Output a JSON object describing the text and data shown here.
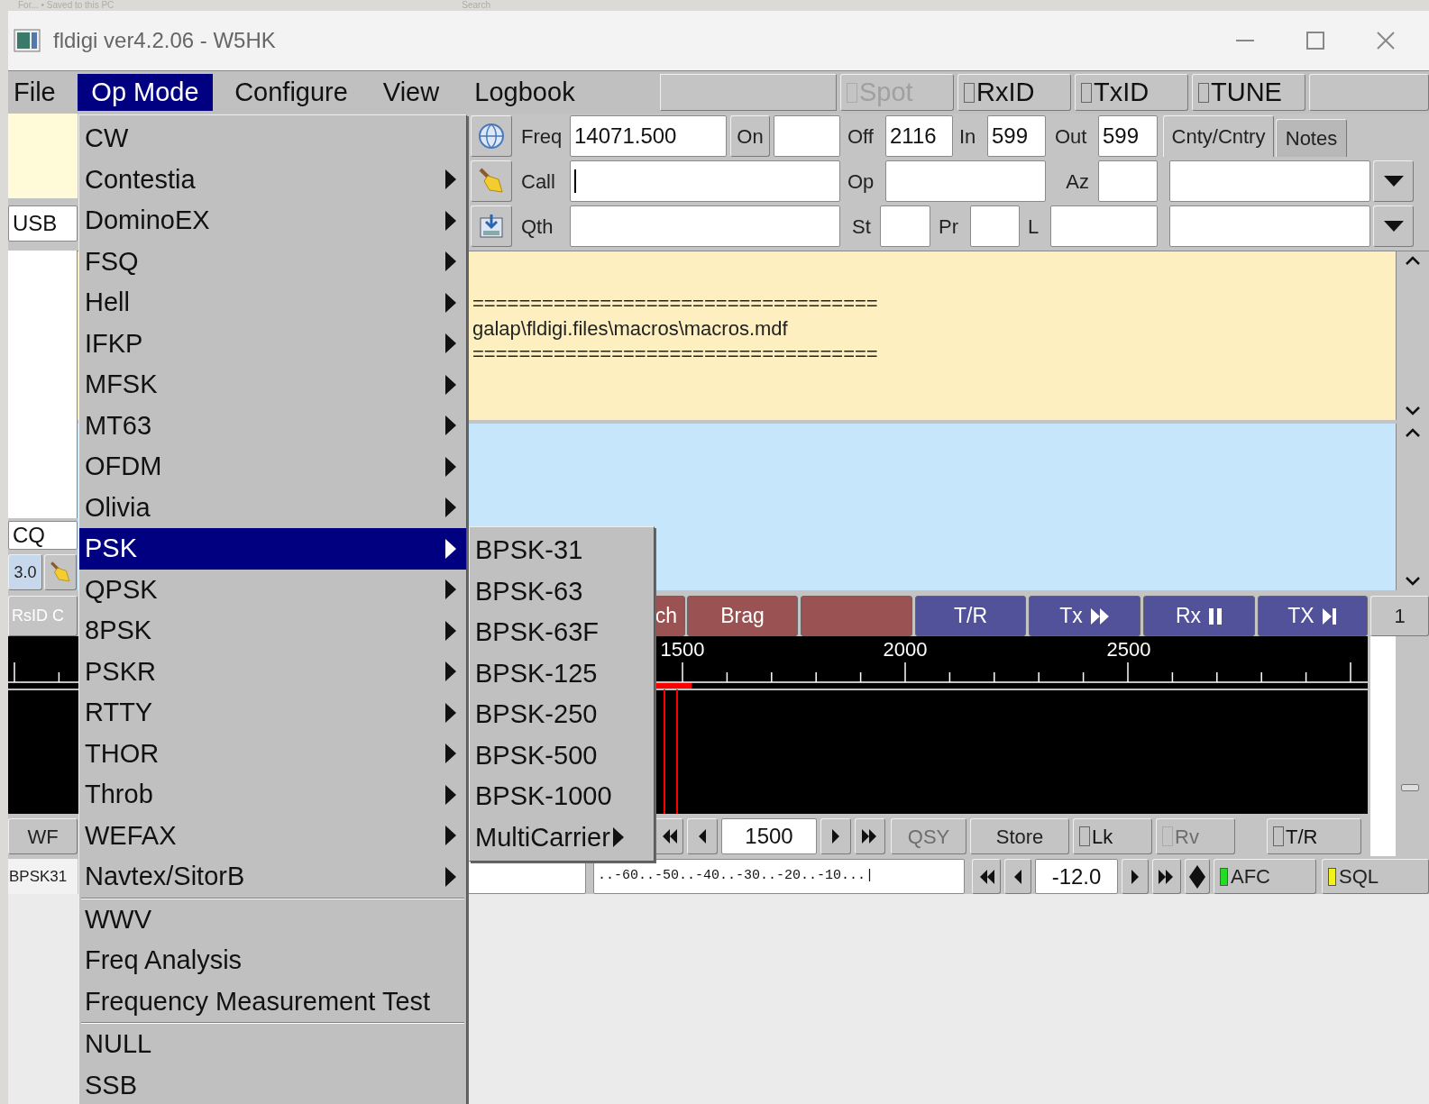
{
  "behind": {
    "breadcrumb": "For... • Saved to this PC",
    "search": "Search"
  },
  "window": {
    "title": "fldigi ver4.2.06 - W5HK"
  },
  "menu_bar": [
    {
      "label": "File",
      "selected": false
    },
    {
      "label": "Op Mode",
      "selected": true
    },
    {
      "label": "Configure",
      "selected": false
    },
    {
      "label": "View",
      "selected": false
    },
    {
      "label": "Logbook",
      "selected": false
    }
  ],
  "toggles": [
    {
      "label": "Spot",
      "checked": false,
      "disabled": true
    },
    {
      "label": "RxID",
      "checked": false,
      "disabled": false
    },
    {
      "label": "TxID",
      "checked": false,
      "disabled": false
    },
    {
      "label": "TUNE",
      "checked": false,
      "disabled": false
    }
  ],
  "left_panel": {
    "mode": "USB",
    "call_field": "CQ",
    "value": "3.0",
    "rsid_button": "RsID C",
    "wf_button": "WF",
    "mode_status": "BPSK31"
  },
  "qso": {
    "freq_label": "Freq",
    "freq": "14071.500",
    "on_button": "On",
    "off_label": "Off",
    "off": "2116",
    "in_label": "In",
    "in": "599",
    "out_label": "Out",
    "out": "599",
    "tabs": [
      {
        "label": "Cnty/Cntry",
        "selected": true
      },
      {
        "label": "Notes",
        "selected": false
      }
    ],
    "call_label": "Call",
    "op_label": "Op",
    "az_label": "Az",
    "qth_label": "Qth",
    "st_label": "St",
    "pr_label": "Pr",
    "l_label": "L"
  },
  "receive_text": [
    "===================================",
    "galap\\fldigi.files\\macros\\macros.mdf",
    "==================================="
  ],
  "macros": [
    {
      "label": "ch",
      "color": "#9a5252"
    },
    {
      "label": "Brag",
      "color": "#9a5252"
    },
    {
      "color": "#9a5252"
    },
    {
      "label": "T/R",
      "color": "#52529a"
    },
    {
      "label": "Tx",
      "kind": "fast-forward",
      "color": "#52529a"
    },
    {
      "label": "Rx",
      "kind": "pause",
      "color": "#52529a"
    },
    {
      "label": "TX",
      "kind": "play-end",
      "color": "#52529a"
    }
  ],
  "macro_page": "1",
  "waterfall": {
    "scale_labels": [
      "1500",
      "2000",
      "2500"
    ]
  },
  "controls": {
    "frequency": "1500",
    "qsy": {
      "label": "QSY",
      "disabled": true
    },
    "store": "Store",
    "toggles": [
      {
        "label": "Lk",
        "checked": false,
        "disabled": false
      },
      {
        "label": "Rv",
        "checked": false,
        "disabled": true
      },
      {
        "label": "T/R",
        "checked": false,
        "disabled": false
      }
    ]
  },
  "status": {
    "meter_scale": "..-60..-50..-40..-30..-20..-10...|",
    "level": "-12.0",
    "indicators": [
      {
        "label": "AFC",
        "color": "#22dd22"
      },
      {
        "label": "SQL",
        "color": "#f2f21e"
      }
    ]
  },
  "op_mode_menu": [
    {
      "kind": "item",
      "label": "CW",
      "submenu": false,
      "selected": false
    },
    {
      "kind": "item",
      "label": "Contestia",
      "submenu": true,
      "selected": false
    },
    {
      "kind": "item",
      "label": "DominoEX",
      "submenu": true,
      "selected": false
    },
    {
      "kind": "item",
      "label": "FSQ",
      "submenu": true,
      "selected": false
    },
    {
      "kind": "item",
      "label": "Hell",
      "submenu": true,
      "selected": false
    },
    {
      "kind": "item",
      "label": "IFKP",
      "submenu": true,
      "selected": false
    },
    {
      "kind": "item",
      "label": "MFSK",
      "submenu": true,
      "selected": false
    },
    {
      "kind": "item",
      "label": "MT63",
      "submenu": true,
      "selected": false
    },
    {
      "kind": "item",
      "label": "OFDM",
      "submenu": true,
      "selected": false
    },
    {
      "kind": "item",
      "label": "Olivia",
      "submenu": true,
      "selected": false
    },
    {
      "kind": "item",
      "label": "PSK",
      "submenu": true,
      "selected": true
    },
    {
      "kind": "item",
      "label": "QPSK",
      "submenu": true,
      "selected": false
    },
    {
      "kind": "item",
      "label": "8PSK",
      "submenu": true,
      "selected": false
    },
    {
      "kind": "item",
      "label": "PSKR",
      "submenu": true,
      "selected": false
    },
    {
      "kind": "item",
      "label": "RTTY",
      "submenu": true,
      "selected": false
    },
    {
      "kind": "item",
      "label": "THOR",
      "submenu": true,
      "selected": false
    },
    {
      "kind": "item",
      "label": "Throb",
      "submenu": true,
      "selected": false
    },
    {
      "kind": "item",
      "label": "WEFAX",
      "submenu": true,
      "selected": false
    },
    {
      "kind": "item",
      "label": "Navtex/SitorB",
      "submenu": true,
      "selected": false
    },
    {
      "kind": "separator"
    },
    {
      "kind": "item",
      "label": "WWV",
      "submenu": false,
      "selected": false
    },
    {
      "kind": "item",
      "label": "Freq Analysis",
      "submenu": false,
      "selected": false
    },
    {
      "kind": "item",
      "label": "Frequency Measurement Test",
      "submenu": false,
      "selected": false
    },
    {
      "kind": "separator"
    },
    {
      "kind": "item",
      "label": "NULL",
      "submenu": false,
      "selected": false
    },
    {
      "kind": "item",
      "label": "SSB",
      "submenu": false,
      "selected": false
    }
  ],
  "psk_submenu": [
    {
      "label": "BPSK-31",
      "submenu": false
    },
    {
      "label": "BPSK-63",
      "submenu": false
    },
    {
      "label": "BPSK-63F",
      "submenu": false
    },
    {
      "label": "BPSK-125",
      "submenu": false
    },
    {
      "label": "BPSK-250",
      "submenu": false
    },
    {
      "label": "BPSK-500",
      "submenu": false
    },
    {
      "label": "BPSK-1000",
      "submenu": false
    },
    {
      "label": "MultiCarrier",
      "submenu": true
    }
  ]
}
